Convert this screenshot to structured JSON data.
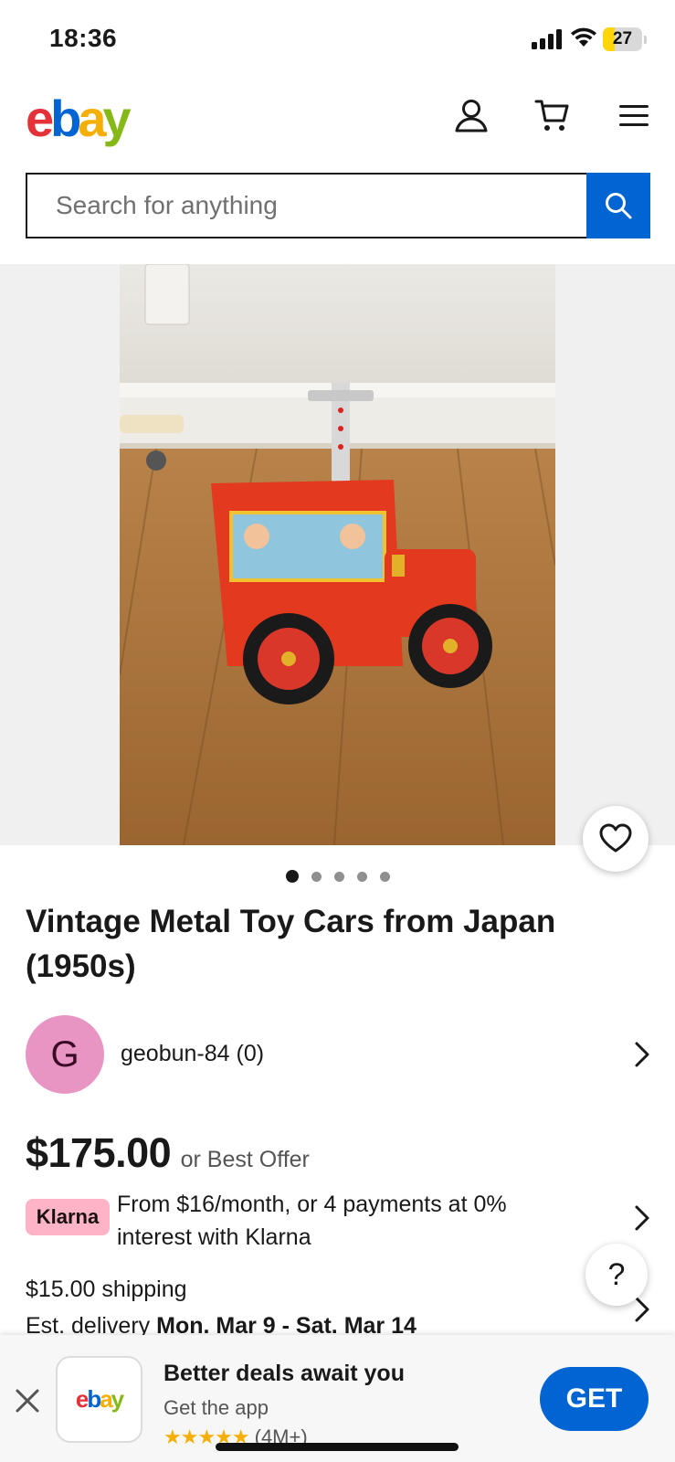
{
  "status_bar": {
    "time": "18:36",
    "battery": "27"
  },
  "header": {
    "logo": {
      "e": "e",
      "b": "b",
      "a": "a",
      "y": "y"
    }
  },
  "search": {
    "placeholder": "Search for anything"
  },
  "gallery": {
    "image_count": 5,
    "active_index": 0
  },
  "listing": {
    "title": "Vintage Metal Toy Cars from Japan (1950s)",
    "seller": {
      "initial": "G",
      "name": "geobun-84 (0)"
    },
    "price": "$175.00",
    "price_suffix": "or Best Offer",
    "klarna": {
      "badge": "Klarna",
      "text": "From $16/month, or 4 payments at 0% interest with Klarna"
    },
    "shipping": "$15.00 shipping",
    "delivery_prefix": "Est. delivery",
    "delivery_dates": "Mon. Mar 9 - Sat. Mar 14"
  },
  "help": {
    "label": "?"
  },
  "app_banner": {
    "headline": "Better deals await you",
    "subtitle": "Get the app",
    "stars": "★★★★★",
    "rating_count": "(4M+)",
    "cta": "GET"
  },
  "colors": {
    "brand_blue": "#0064d2",
    "logo_red": "#e53238",
    "logo_yellow": "#f5af02",
    "logo_green": "#86b817",
    "avatar_pink": "#e895c4",
    "klarna_pink": "#ffb3c7"
  }
}
